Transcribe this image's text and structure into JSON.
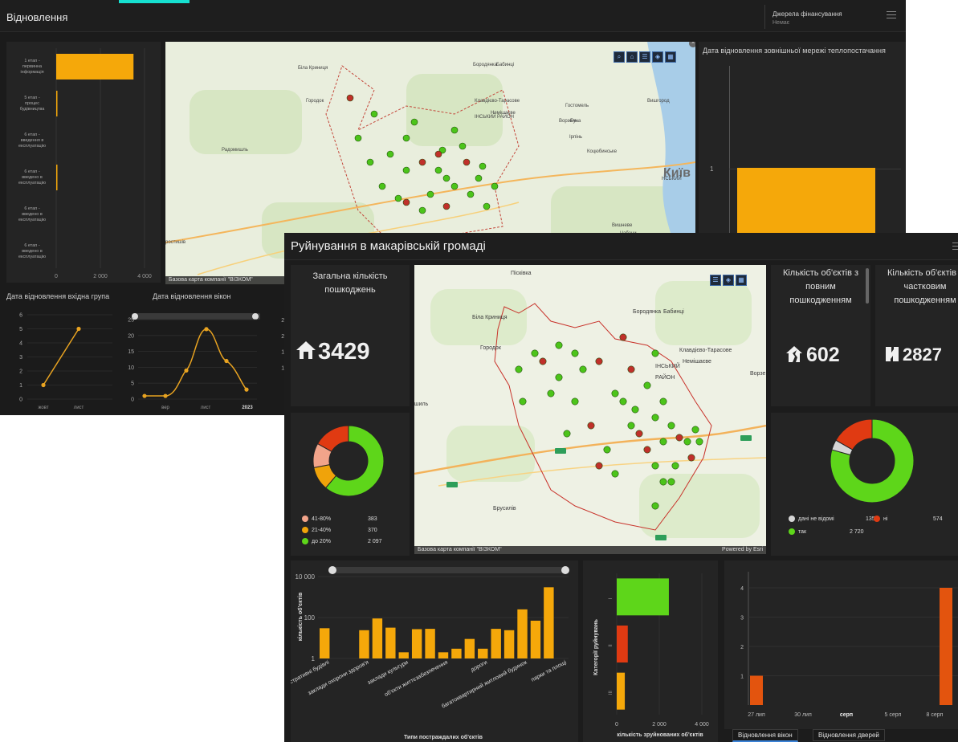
{
  "back_dashboard": {
    "title": "Відновлення",
    "funding": {
      "label": "Джерела фінансування",
      "value": "Немає"
    },
    "stage_chart": {
      "categories": [
        "1 етап - первинна інформація",
        "5 етап - процес будівництва",
        "6 етап - введення в експлуатацію",
        "6 етап - введено в експлуатацію",
        "6 етап - введено в експлуатацію",
        "6 етап - введено в експлуатацію"
      ],
      "category_lines": [
        [
          "1 етап -",
          "первинна",
          "інформація"
        ],
        [
          "5 етап -",
          "процес",
          "будівництва"
        ],
        [
          "6 етап -",
          "введення в",
          "експлуатацію"
        ],
        [
          "6 етап -",
          "введено в",
          "експлуатацію"
        ],
        [
          "6 етап -",
          "введено в",
          "експлуатацію"
        ],
        [
          "6 етап -",
          "введено в",
          "експлуатацію"
        ]
      ],
      "x_ticks": [
        "0",
        "2 000",
        "4 000"
      ]
    },
    "map": {
      "attribution": "Базова карта компанії \"ВІЗКОМ\"",
      "places": [
        "Біла Криниця",
        "Бородянка",
        "Бабинці",
        "Городок",
        "Клавдієво-Тарасове",
        "Немішаєве",
        "Гостомель",
        "Вишгород",
        "Ворзель",
        "Буча",
        "Ірпінь",
        "Коцюбинське",
        "Радомишль",
        "Київ",
        "Вишневе",
        "Чабани",
        "ростишів",
        "ІНСЬКИЙ РАЙОН",
        "НСЬКИЙ"
      ]
    },
    "heat_chart": {
      "title": "Дата відновлення зовнішньої мережі теплопостачання",
      "y_tick": "1"
    },
    "entrance_chart": {
      "title": "Дата відновлення вхідна група",
      "y_ticks": [
        "0",
        "1",
        "2",
        "3",
        "4",
        "5",
        "6"
      ],
      "x_ticks": [
        "жовт",
        "лист"
      ]
    },
    "windows_chart": {
      "title": "Дата відновлення вікон",
      "y_ticks": [
        "0",
        "5",
        "10",
        "15",
        "20",
        "25"
      ],
      "x_ticks": [
        "вер",
        "лист",
        "2023"
      ]
    },
    "extra_y_ticks": [
      "0",
      "5",
      "10",
      "15",
      "20",
      "25"
    ]
  },
  "front_dashboard": {
    "title": "Руйнування в макарівській громаді",
    "total": {
      "title": "Загальна кількість пошкоджень",
      "value": "3429"
    },
    "full_damage": {
      "title": "Кількість об'єктів з повним пошкодженням",
      "value": "602"
    },
    "partial_damage": {
      "title": "Кількість об'єктів з частковим пошкодженням",
      "value": "2827"
    },
    "map": {
      "attribution": "Базова карта компанії \"ВІЗКОМ\"",
      "powered": "Powered by Esri",
      "places": [
        "Пісківка",
        "Бородянка",
        "Бабинці",
        "Біла Криниця",
        "Городок",
        "Клавдієво-Тарасове",
        "Немішаєве",
        "Ворзе",
        "ІНСЬКИЙ",
        "РАЙОН",
        "Брусилів",
        "шиль"
      ]
    },
    "donut_left": {
      "legend": [
        {
          "label": "41-80%",
          "value": "383",
          "color": "#f2a48a"
        },
        {
          "label": "21-40%",
          "value": "370",
          "color": "#f0a30a"
        },
        {
          "label": "до 20%",
          "value": "2 097",
          "color": "#5ed61a"
        }
      ],
      "color_red": "#e03a12"
    },
    "donut_right": {
      "legend": [
        {
          "label": "дані не відомі",
          "value": "135",
          "color": "#d6d6d6"
        },
        {
          "label": "ні",
          "value": "574",
          "color": "#e03a12"
        },
        {
          "label": "так",
          "value": "2 720",
          "color": "#5ed61a"
        }
      ]
    },
    "tabs": [
      "Відновлення вікон",
      "Відновлення дверей"
    ]
  },
  "chart_data": [
    {
      "type": "bar",
      "orientation": "horizontal",
      "categories": [
        "1 етап - первинна інформація",
        "5 етап - процес будівництва",
        "6 етап - введення в експлуатацію",
        "6 етап - введено в експлуатацію",
        "6 етап - введено в експлуатацію",
        "6 етап - введено в експлуатацію"
      ],
      "values": [
        3500,
        20,
        0,
        30,
        0,
        0
      ],
      "xlim": [
        0,
        4000
      ],
      "color": "#f5a80a"
    },
    {
      "type": "bar",
      "title": "Дата відновлення зовнішньої мережі теплопостачання",
      "values": [
        1
      ],
      "color": "#f5a80a"
    },
    {
      "type": "line",
      "title": "Дата відновлення вхідна група",
      "categories": [
        "жовт",
        "лист"
      ],
      "values": [
        1,
        5
      ],
      "ylim": [
        0,
        6
      ],
      "color": "#e8a321"
    },
    {
      "type": "line",
      "title": "Дата відновлення вікон",
      "x": [
        0,
        1,
        2,
        3,
        4,
        5,
        6
      ],
      "values": [
        1,
        1,
        9,
        22,
        12,
        3
      ],
      "x_ticks": [
        "вер",
        "лист",
        "2023"
      ],
      "ylim": [
        0,
        25
      ],
      "color": "#e8a321"
    },
    {
      "type": "bar",
      "ylabel": "кількість об'єктів",
      "xlabel": "Типи постраждалих об'єктів",
      "yscale": "log",
      "ylim": [
        1,
        10000
      ],
      "y_ticks": [
        "1",
        "100",
        "10 000"
      ],
      "categories": [
        "адміністративні будівлі",
        "",
        "",
        "заклади охорони здоров'я",
        "",
        "",
        "заклади культури",
        "",
        "",
        "об'єкти життєзабезпечення",
        "",
        "",
        "дороги",
        "",
        "",
        "багатоквартирний житловий будинок",
        "",
        "",
        "парки та площі"
      ],
      "values": [
        30,
        1,
        1,
        24,
        90,
        32,
        2,
        27,
        28,
        2,
        3,
        9,
        3,
        28,
        24,
        250,
        70,
        3000,
        1
      ],
      "color": "#f5a80a"
    },
    {
      "type": "bar",
      "orientation": "horizontal",
      "xlabel": "кількість зруйнованих об'єктів",
      "ylabel": "Категорії руйнувань",
      "categories": [
        "I",
        "II",
        "III"
      ],
      "values": [
        2450,
        520,
        380
      ],
      "colors": [
        "#5ed61a",
        "#e03a12",
        "#f5a80a"
      ],
      "xlim": [
        0,
        4000
      ],
      "x_ticks": [
        "0",
        "2 000",
        "4 000"
      ]
    },
    {
      "type": "bar",
      "categories": [
        "27 лип",
        "30 лип",
        "серп",
        "5 серп",
        "8 серп"
      ],
      "values": [
        1,
        0,
        0,
        0,
        4
      ],
      "ylim": [
        0,
        4
      ],
      "y_ticks": [
        "1",
        "2",
        "3",
        "4"
      ],
      "color": "#e3540e"
    }
  ]
}
